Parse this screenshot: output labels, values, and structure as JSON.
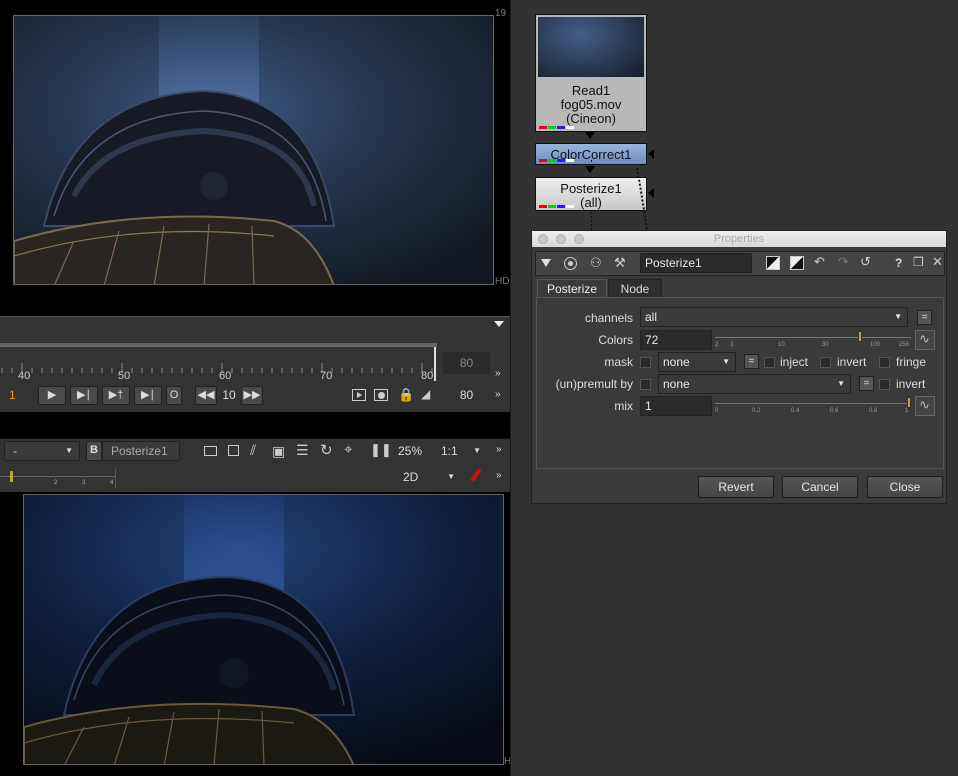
{
  "viewer_top": {
    "frame_number": "19",
    "format_label": "HD"
  },
  "timeline": {
    "ruler_labels": [
      "40",
      "50",
      "60",
      "70",
      "80"
    ],
    "end_frame_dim": "80",
    "current_frame": "1",
    "out_button": "O",
    "step_value": "10",
    "end_frame": "80"
  },
  "viewer_bottom": {
    "a_input": "-",
    "b_label": "B",
    "b_input": "Posterize1",
    "zoom": "25%",
    "ratio": "1:1",
    "ruler_labels": [
      "2",
      "3",
      "4"
    ],
    "view_mode": "2D",
    "format_label": "H"
  },
  "dag": {
    "read_node": {
      "line1": "Read1",
      "line2": "fog05.mov",
      "line3": "(Cineon)"
    },
    "colorcorrect_node": {
      "label": "ColorCorrect1"
    },
    "posterize_node": {
      "line1": "Posterize1",
      "line2": "(all)"
    }
  },
  "properties": {
    "title": "Properties",
    "node_name": "Posterize1",
    "help": "?",
    "tabs": [
      "Posterize",
      "Node"
    ],
    "channels_label": "channels",
    "channels_value": "all",
    "colors_label": "Colors",
    "colors_value": "72",
    "colors_ticks": [
      "2",
      "3",
      "10",
      "30",
      "100",
      "256"
    ],
    "mask_label": "mask",
    "mask_value": "none",
    "inject_label": "inject",
    "invert_label": "invert",
    "fringe_label": "fringe",
    "premult_label": "(un)premult by",
    "premult_value": "none",
    "premult_invert_label": "invert",
    "mix_label": "mix",
    "mix_value": "1",
    "mix_ticks": [
      "0",
      "0.2",
      "0.4",
      "0.6",
      "0.8",
      "1"
    ],
    "eq": "=",
    "buttons": {
      "revert": "Revert",
      "cancel": "Cancel",
      "close": "Close"
    }
  },
  "colors": {
    "accent_handle": "#c8a040",
    "node_cc": "#7d9bc8",
    "node_read": "#b8b8b8",
    "flag_red": "#d01010"
  }
}
